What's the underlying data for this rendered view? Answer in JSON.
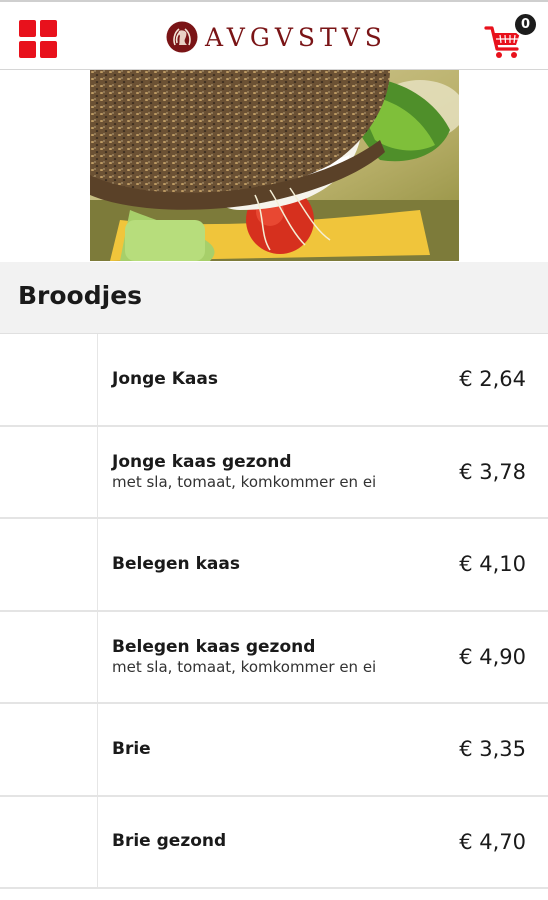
{
  "header": {
    "brand_name": "AVGVSTVS",
    "cart_count": "0",
    "icons": {
      "menu": "grid-menu-icon",
      "cart": "shopping-cart-icon",
      "logo": "laurel-emblem-icon"
    },
    "colors": {
      "accent": "#e8111c",
      "brand": "#7a1416"
    }
  },
  "section": {
    "title": "Broodjes"
  },
  "products": [
    {
      "name": "Jonge Kaas",
      "description": "",
      "price": "€ 2,64"
    },
    {
      "name": "Jonge kaas gezond",
      "description": "met sla, tomaat, komkommer en ei",
      "price": "€ 3,78"
    },
    {
      "name": "Belegen kaas",
      "description": "",
      "price": "€ 4,10"
    },
    {
      "name": "Belegen kaas gezond",
      "description": "met sla, tomaat, komkommer en ei",
      "price": "€ 4,90"
    },
    {
      "name": "Brie",
      "description": "",
      "price": "€ 3,35"
    },
    {
      "name": "Brie gezond",
      "description": "",
      "price": "€ 4,70"
    }
  ]
}
